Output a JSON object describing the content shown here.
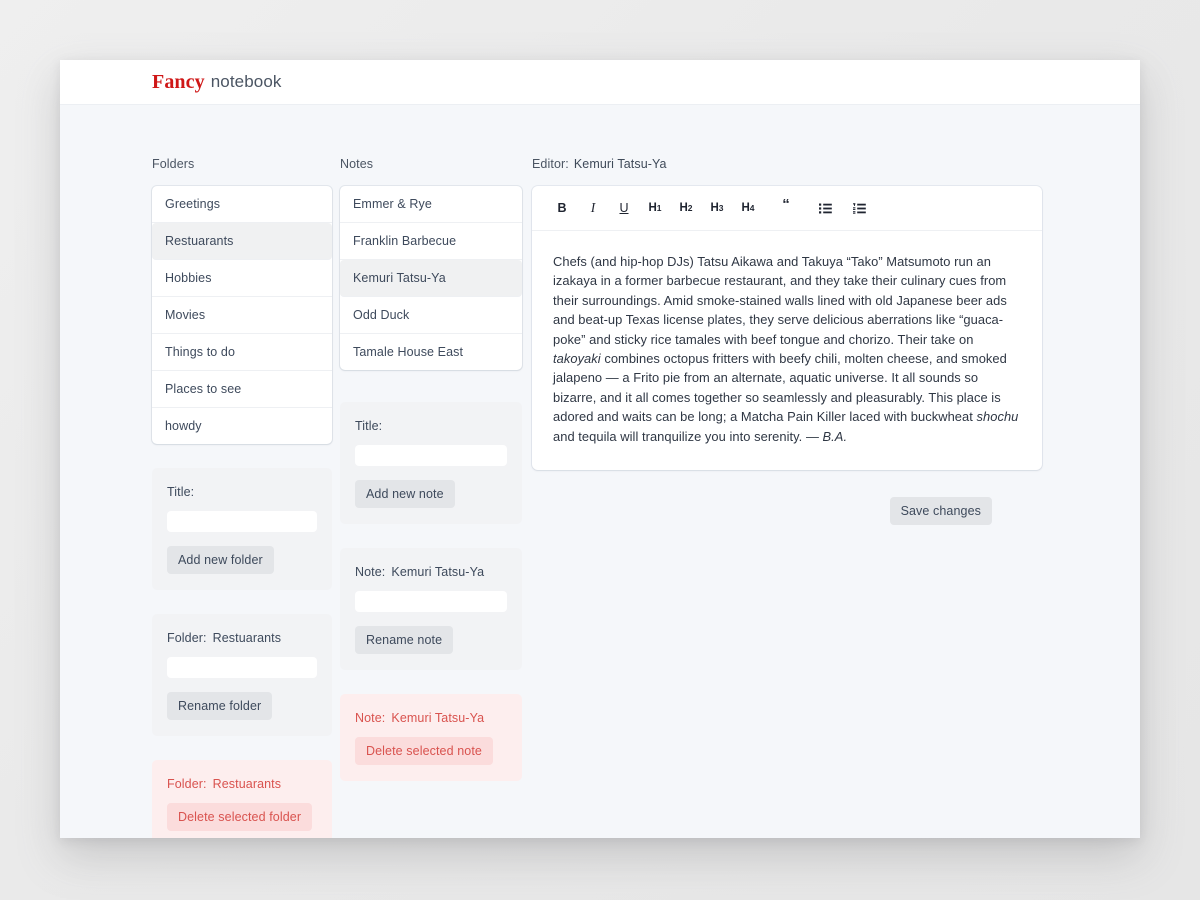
{
  "brand": {
    "fancy": "Fancy",
    "notebook": "notebook"
  },
  "columns": {
    "folders_head": "Folders",
    "notes_head": "Notes",
    "editor_head_label": "Editor:",
    "editor_head_value": "Kemuri Tatsu-Ya"
  },
  "folders": {
    "items": [
      {
        "label": "Greetings",
        "selected": false
      },
      {
        "label": "Restuarants",
        "selected": true
      },
      {
        "label": "Hobbies",
        "selected": false
      },
      {
        "label": "Movies",
        "selected": false
      },
      {
        "label": "Things to do",
        "selected": false
      },
      {
        "label": "Places to see",
        "selected": false
      },
      {
        "label": "howdy",
        "selected": false
      }
    ],
    "add_panel": {
      "label": "Title:",
      "input_value": "",
      "button": "Add new folder"
    },
    "rename_panel": {
      "label": "Folder:",
      "value": "Restuarants",
      "input_value": "",
      "button": "Rename folder"
    },
    "delete_panel": {
      "label": "Folder:",
      "value": "Restuarants",
      "button": "Delete selected folder"
    }
  },
  "notes": {
    "items": [
      {
        "label": "Emmer & Rye",
        "selected": false
      },
      {
        "label": "Franklin Barbecue",
        "selected": false
      },
      {
        "label": "Kemuri Tatsu-Ya",
        "selected": true
      },
      {
        "label": "Odd Duck",
        "selected": false
      },
      {
        "label": "Tamale House East",
        "selected": false
      }
    ],
    "add_panel": {
      "label": "Title:",
      "input_value": "",
      "button": "Add new note"
    },
    "rename_panel": {
      "label": "Note:",
      "value": "Kemuri Tatsu-Ya",
      "input_value": "",
      "button": "Rename note"
    },
    "delete_panel": {
      "label": "Note:",
      "value": "Kemuri Tatsu-Ya",
      "button": "Delete selected note"
    }
  },
  "editor": {
    "toolbar": [
      {
        "name": "bold",
        "label": "B"
      },
      {
        "name": "italic",
        "label": "I"
      },
      {
        "name": "underline",
        "label": "U"
      },
      {
        "name": "heading-1",
        "label": "H",
        "sub": "1"
      },
      {
        "name": "heading-2",
        "label": "H",
        "sub": "2"
      },
      {
        "name": "heading-3",
        "label": "H",
        "sub": "3"
      },
      {
        "name": "heading-4",
        "label": "H",
        "sub": "4"
      },
      {
        "name": "blockquote",
        "label": "“"
      },
      {
        "name": "bulleted-list",
        "label": ""
      },
      {
        "name": "numbered-list",
        "label": ""
      }
    ],
    "content": {
      "part1": "Chefs (and hip-hop DJs) Tatsu Aikawa and Takuya “Tako” Matsumoto run an izakaya in a former barbecue restaurant, and they take their culinary cues from their surroundings. Amid smoke-stained walls lined with old Japanese beer ads and beat-up Texas license plates, they serve delicious aberrations like “guaca-poke” and sticky rice tamales with beef tongue and chorizo. Their take on ",
      "italic1": "takoyaki",
      "part2": " combines octopus fritters with beefy chili, molten cheese, and smoked jalapeno — a Frito pie from an alternate, aquatic universe. It all sounds so bizarre, and it all comes together so seamlessly and pleasurably. This place is adored and waits can be long; a Matcha Pain Killer laced with buckwheat ",
      "italic2": "shochu",
      "part3": " and tequila will tranquilize you into serenity. — ",
      "italic3": "B.A."
    },
    "save_button": "Save changes"
  }
}
